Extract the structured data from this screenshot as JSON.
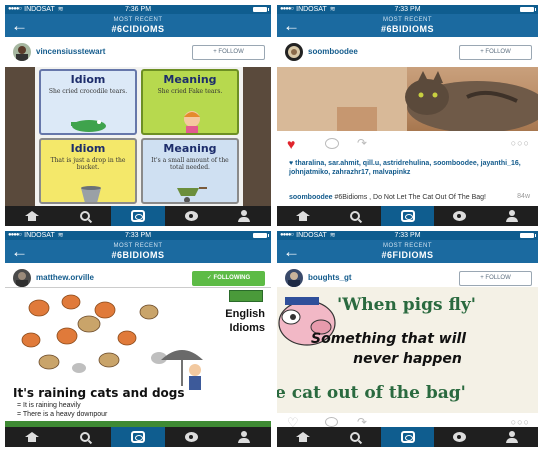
{
  "panels": [
    {
      "status": {
        "carrier": "INDOSAT",
        "time": "7:36 PM"
      },
      "header": {
        "subtitle": "MOST RECENT",
        "tag": "#6CIDIOMS"
      },
      "user": {
        "name": "vincensiusstewart",
        "follow_label": "+ FOLLOW"
      },
      "cards": [
        {
          "title": "Idiom",
          "text": "She cried crocodile tears."
        },
        {
          "title": "Meaning",
          "text": "She cried Fake tears."
        },
        {
          "title": "Idiom",
          "text": "That is just a drop in the bucket."
        },
        {
          "title": "Meaning",
          "text": "It's a small amount of the total needed."
        }
      ]
    },
    {
      "status": {
        "carrier": "INDOSAT",
        "time": "7:33 PM"
      },
      "header": {
        "subtitle": "MOST RECENT",
        "tag": "#6BIDIOMS"
      },
      "user": {
        "name": "soomboodee",
        "follow_label": "+ FOLLOW"
      },
      "likes": "tharalina, sar.ahmit, qill.u, astridrehulina, soomboodee, jayanthi_16, johnjatmiko, zahrazhr17, malvapinkz",
      "caption_user": "soomboodee",
      "caption_text": "#6Bidioms , Do Not Let The Cat Out Of The Bag!",
      "time_ago": "84w"
    },
    {
      "status": {
        "carrier": "INDOSAT",
        "time": "7:33 PM"
      },
      "header": {
        "subtitle": "MOST RECENT",
        "tag": "#6BIDIOMS"
      },
      "user": {
        "name": "matthew.orville",
        "follow_label": "✓ FOLLOWING"
      },
      "poster": {
        "title_line1": "English",
        "title_line2": "Idioms",
        "headline": "It's raining cats and dogs",
        "bullet1": "= It is raining heavily",
        "bullet2": "= There is a heavy downpour"
      }
    },
    {
      "status": {
        "carrier": "INDOSAT",
        "time": "7:33 PM"
      },
      "header": {
        "subtitle": "MOST RECENT",
        "tag": "#6FIDIOMS"
      },
      "user": {
        "name": "boughts_gt",
        "follow_label": "+ FOLLOW"
      },
      "poster": {
        "line1": "'When pigs fly'",
        "line2": "Something that will",
        "line3": "never happen",
        "line4": "e cat out of the bag'"
      }
    }
  ],
  "colors": {
    "status": "#0f5d8f",
    "header": "#1b6aa0",
    "nav": "#1f1f1f",
    "following": "#5dbb46",
    "heart": "#e0242c"
  }
}
